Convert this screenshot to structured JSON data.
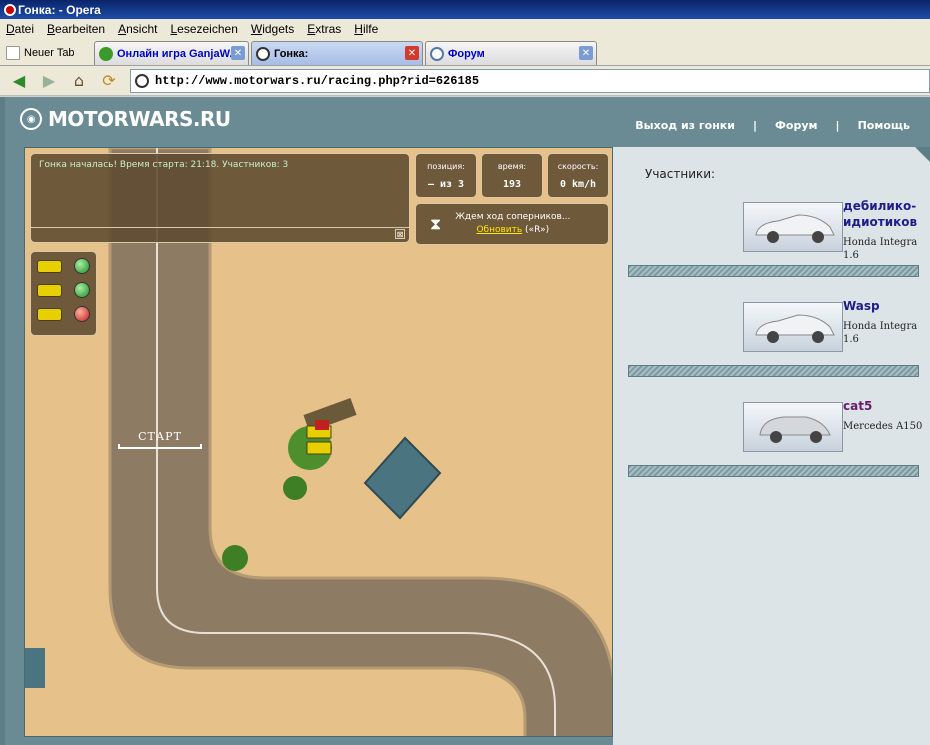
{
  "window": {
    "title": "Гонка: - Opera"
  },
  "menu": {
    "items": [
      "Datei",
      "Bearbeiten",
      "Ansicht",
      "Lesezeichen",
      "Widgets",
      "Extras",
      "Hilfe"
    ]
  },
  "tabs": [
    {
      "label": "Neuer Tab"
    },
    {
      "label": "Онлайн игра GanjaW..."
    },
    {
      "label": "Гонка:"
    },
    {
      "label": "Форум"
    }
  ],
  "address": {
    "url": "http://www.motorwars.ru/racing.php?rid=626185"
  },
  "site": {
    "logo": "MOTORWARS.RU",
    "nav": [
      "Выход из гонки",
      "Форум",
      "Помощь"
    ]
  },
  "game": {
    "info": "Гонка началась! Время старта: 21:18. Участников: 3",
    "stats": [
      {
        "label": "позиция:",
        "value": "– из 3"
      },
      {
        "label": "время:",
        "value": "193"
      },
      {
        "label": "скорость:",
        "value": "0 km/h"
      }
    ],
    "waiting": "Ждем ход соперников...",
    "refresh": "Обновить",
    "refresh_key": "(«R»)",
    "start_label": "СТАРТ",
    "lights": [
      "green",
      "green",
      "red"
    ]
  },
  "participants": {
    "title": "Участники:",
    "list": [
      {
        "name": "дебилико-идиотиков",
        "model": "Honda Integra 1.6"
      },
      {
        "name": "Wasp",
        "model": "Honda Integra 1.6"
      },
      {
        "name": "cat5",
        "model": "Mercedes A150"
      }
    ]
  },
  "colors": {
    "accent": "#6a8b93",
    "sand": "#e6c28a",
    "road": "#8d7b63"
  }
}
